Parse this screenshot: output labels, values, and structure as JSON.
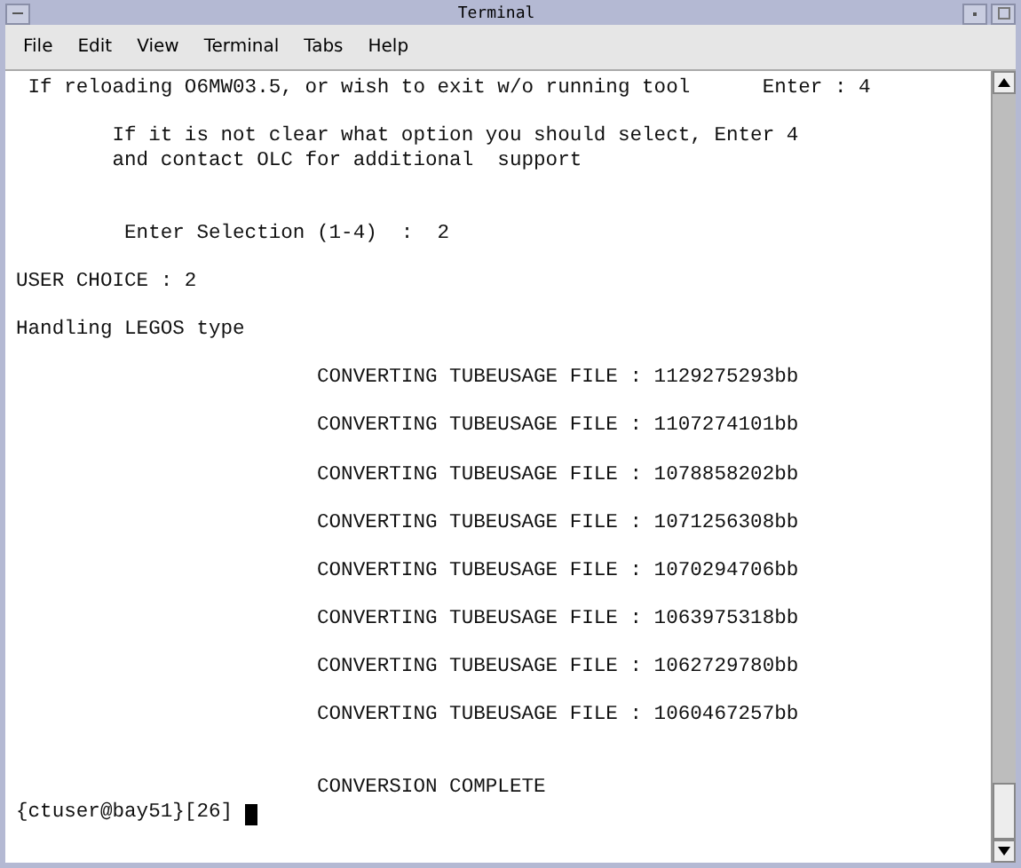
{
  "window": {
    "title": "Terminal"
  },
  "menu": [
    "File",
    "Edit",
    "View",
    "Terminal",
    "Tabs",
    "Help"
  ],
  "terminal": {
    "lines": [
      {
        "kind": "text",
        "text": " If reloading O6MW03.5, or wish to exit w/o running tool      Enter : 4"
      },
      {
        "kind": "blank"
      },
      {
        "kind": "text",
        "text": "        If it is not clear what option you should select, Enter 4"
      },
      {
        "kind": "text",
        "text": "        and contact OLC for additional  support"
      },
      {
        "kind": "blank"
      },
      {
        "kind": "blank"
      },
      {
        "kind": "text",
        "text": "         Enter Selection (1-4)  :  2"
      },
      {
        "kind": "blank"
      },
      {
        "kind": "text",
        "text": "USER CHOICE : 2"
      },
      {
        "kind": "blank"
      },
      {
        "kind": "text",
        "text": "Handling LEGOS type"
      },
      {
        "kind": "blank"
      },
      {
        "kind": "text",
        "text": "                         CONVERTING TUBEUSAGE FILE : 1129275293bb"
      },
      {
        "kind": "blank"
      },
      {
        "kind": "text",
        "text": "                         CONVERTING TUBEUSAGE FILE : 1107274101bb"
      },
      {
        "kind": "blank"
      },
      {
        "kind": "text",
        "text": "                         CONVERTING TUBEUSAGE FILE : 1078858202bb"
      },
      {
        "kind": "blank"
      },
      {
        "kind": "text",
        "text": "                         CONVERTING TUBEUSAGE FILE : 1071256308bb"
      },
      {
        "kind": "blank"
      },
      {
        "kind": "text",
        "text": "                         CONVERTING TUBEUSAGE FILE : 1070294706bb"
      },
      {
        "kind": "blank"
      },
      {
        "kind": "text",
        "text": "                         CONVERTING TUBEUSAGE FILE : 1063975318bb"
      },
      {
        "kind": "blank"
      },
      {
        "kind": "text",
        "text": "                         CONVERTING TUBEUSAGE FILE : 1062729780bb"
      },
      {
        "kind": "blank"
      },
      {
        "kind": "text",
        "text": "                         CONVERTING TUBEUSAGE FILE : 1060467257bb"
      },
      {
        "kind": "blank"
      },
      {
        "kind": "blank"
      },
      {
        "kind": "text",
        "text": "                         CONVERSION COMPLETE"
      },
      {
        "kind": "prompt",
        "text": "{ctuser@bay51}[26] "
      }
    ]
  }
}
